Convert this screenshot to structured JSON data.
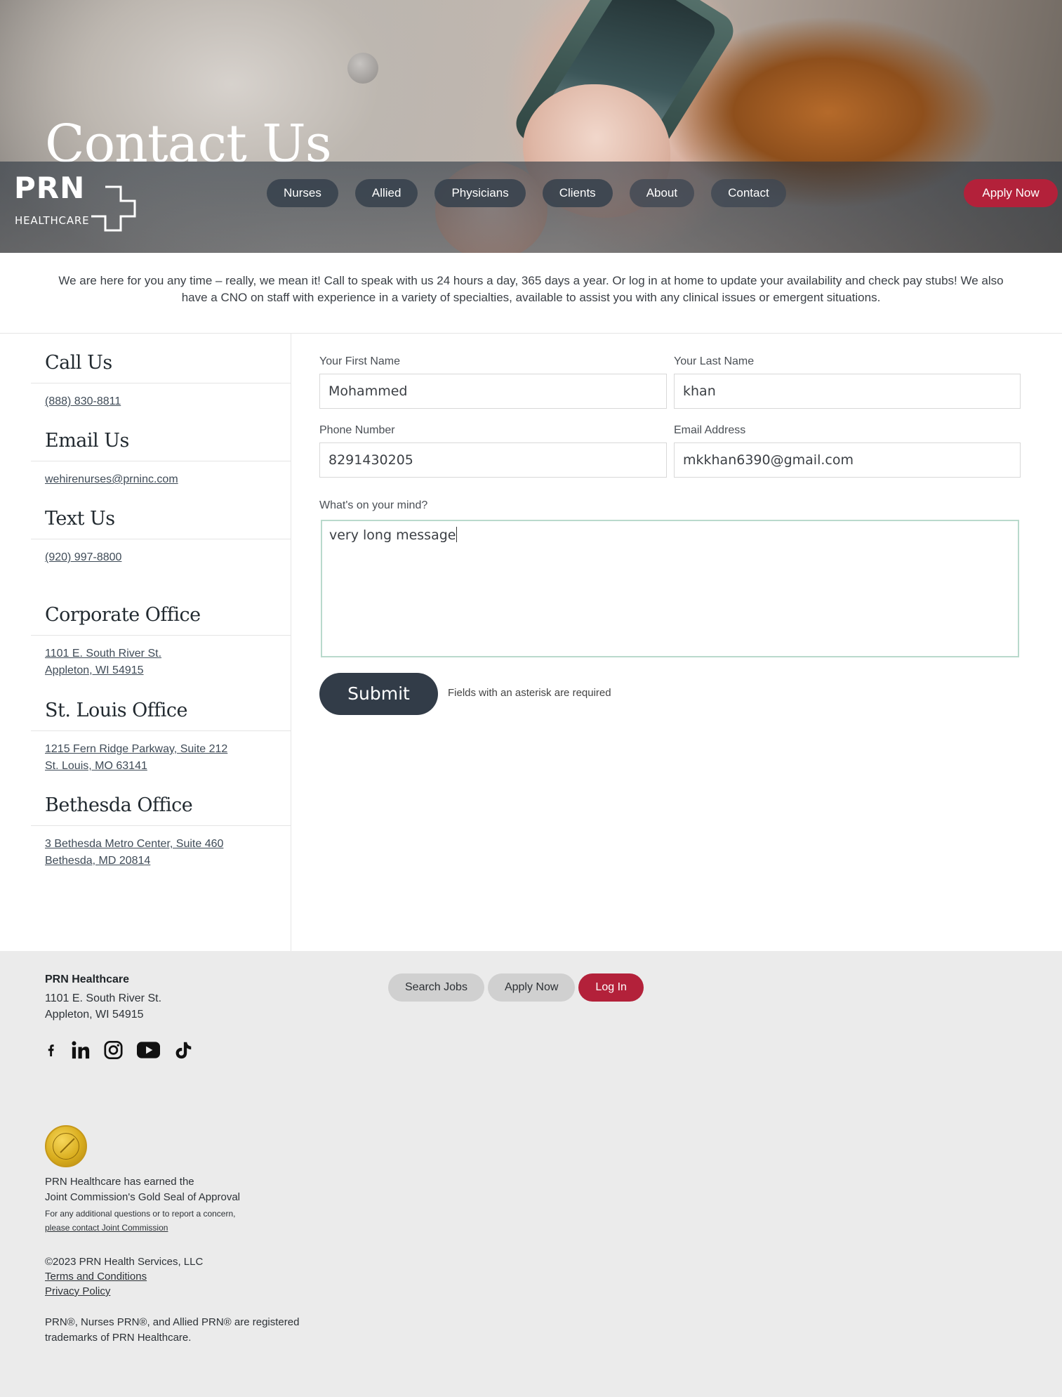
{
  "hero": {
    "title": "Contact Us"
  },
  "logo": {
    "text": "PRN",
    "sub": "HEALTHCARE"
  },
  "nav": {
    "items": [
      "Nurses",
      "Allied",
      "Physicians",
      "Clients",
      "About",
      "Contact"
    ],
    "apply_label": "Apply Now"
  },
  "intro": "We are here for you any time – really, we mean it! Call to speak with us 24 hours a day, 365 days a year. Or log in at home to update your availability and check pay stubs! We also have a CNO on staff with experience in a variety of specialties, available to assist you with any clinical issues or emergent situations.",
  "contacts": {
    "call": {
      "heading": "Call Us",
      "value": "(888) 830-8811"
    },
    "email": {
      "heading": "Email Us",
      "value": "wehirenurses@prninc.com"
    },
    "text": {
      "heading": "Text Us",
      "value": "(920) 997-8800"
    },
    "corporate": {
      "heading": "Corporate Office",
      "line1": "1101 E. South River St.",
      "line2": "Appleton, WI 54915"
    },
    "stlouis": {
      "heading": "St. Louis Office",
      "line1": "1215 Fern Ridge Parkway, Suite 212",
      "line2": "St. Louis, MO 63141"
    },
    "bethesda": {
      "heading": "Bethesda Office",
      "line1": "3 Bethesda Metro Center, Suite 460",
      "line2": "Bethesda, MD 20814"
    }
  },
  "form": {
    "first_name": {
      "label": "Your First Name",
      "value": "Mohammed"
    },
    "last_name": {
      "label": "Your Last Name",
      "value": "khan"
    },
    "phone": {
      "label": "Phone Number",
      "value": "8291430205"
    },
    "email": {
      "label": "Email Address",
      "value": "mkkhan6390@gmail.com"
    },
    "message": {
      "label": "What's on your mind?",
      "value": "very long message"
    },
    "submit_label": "Submit",
    "required_note": "Fields with an asterisk are required"
  },
  "footer": {
    "company": "PRN Healthcare",
    "addr1": "1101 E. South River St.",
    "addr2": "Appleton, WI 54915",
    "buttons": {
      "search": "Search Jobs",
      "apply": "Apply Now",
      "login": "Log In"
    },
    "social_icons": [
      "facebook-icon",
      "linkedin-icon",
      "instagram-icon",
      "youtube-icon",
      "tiktok-icon"
    ],
    "seal_line1": "PRN Healthcare has earned the",
    "seal_line2": "Joint Commission's Gold Seal of Approval",
    "concern": "For any additional questions or to report a concern,",
    "concern_link": "please contact Joint Commission",
    "copyright": "©2023 PRN Health Services, LLC",
    "terms": "Terms and Conditions",
    "privacy": "Privacy Policy",
    "trademark": "PRN®, Nurses PRN®, and Allied PRN® are registered trademarks of PRN Healthcare."
  },
  "colors": {
    "accent_red": "#b3213a",
    "dark_slate": "#323c48",
    "footer_bg": "#ebebeb"
  }
}
